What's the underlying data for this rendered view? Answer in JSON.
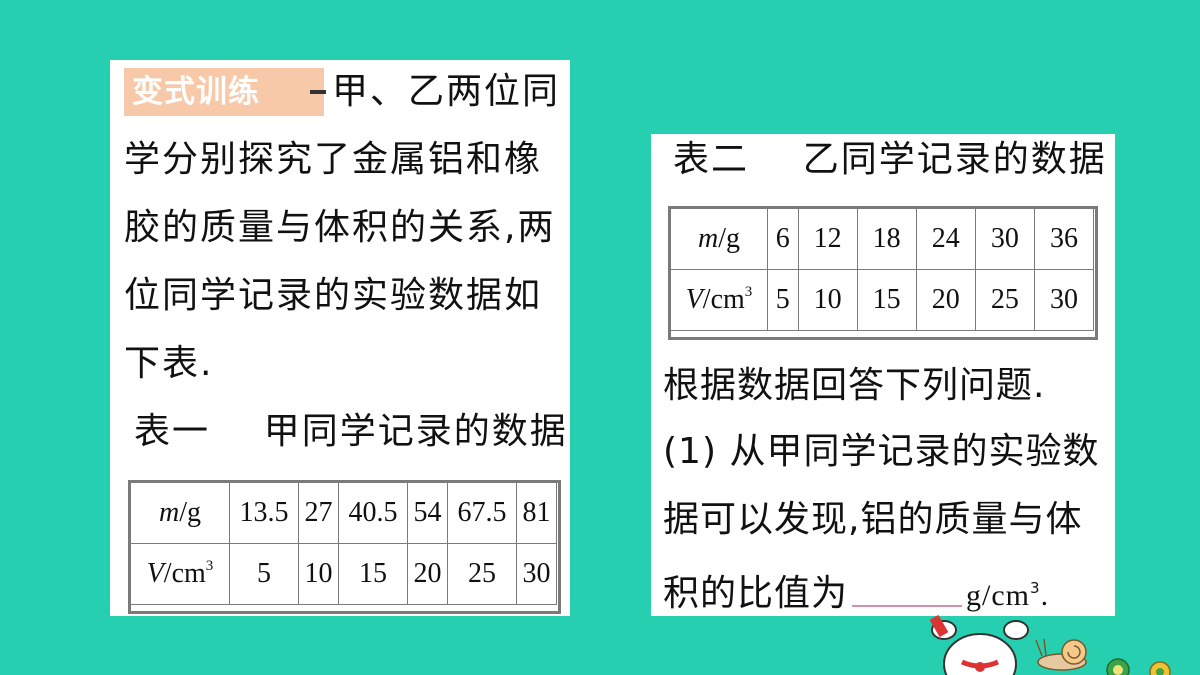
{
  "left": {
    "badge": "变式训练",
    "lines": [
      "甲、乙两位同",
      "学分别探究了金属铝和橡",
      "胶的质量与体积的关系,两",
      "位同学记录的实验数据如",
      "下表."
    ],
    "table_caption": "表一    甲同学记录的数据",
    "table": {
      "row1_label_var": "m",
      "row1_label_unit": "/g",
      "row1": [
        "13.5",
        "27",
        "40.5",
        "54",
        "67.5",
        "81"
      ],
      "row2_label_var": "V",
      "row2_label_unit": "/cm",
      "row2_label_sup": "3",
      "row2": [
        "5",
        "10",
        "15",
        "20",
        "25",
        "30"
      ]
    }
  },
  "right": {
    "table_caption": "表二    乙同学记录的数据",
    "table": {
      "row1_label_var": "m",
      "row1_label_unit": "/g",
      "row1": [
        "6",
        "12",
        "18",
        "24",
        "30",
        "36"
      ],
      "row2_label_var": "V",
      "row2_label_unit": "/cm",
      "row2_label_sup": "3",
      "row2": [
        "5",
        "10",
        "15",
        "20",
        "25",
        "30"
      ]
    },
    "lines": [
      "根据数据回答下列问题.",
      "(1) 从甲同学记录的实验数",
      "据可以发现,铝的质量与体"
    ],
    "last_line_prefix": "积的比值为",
    "last_line_unit": "g/cm",
    "last_line_unit_sup": "3",
    "last_line_end": "."
  },
  "colors": {
    "background": "#26cfb0",
    "badge": "#f7c9a8",
    "border": "#7a7a7a"
  }
}
